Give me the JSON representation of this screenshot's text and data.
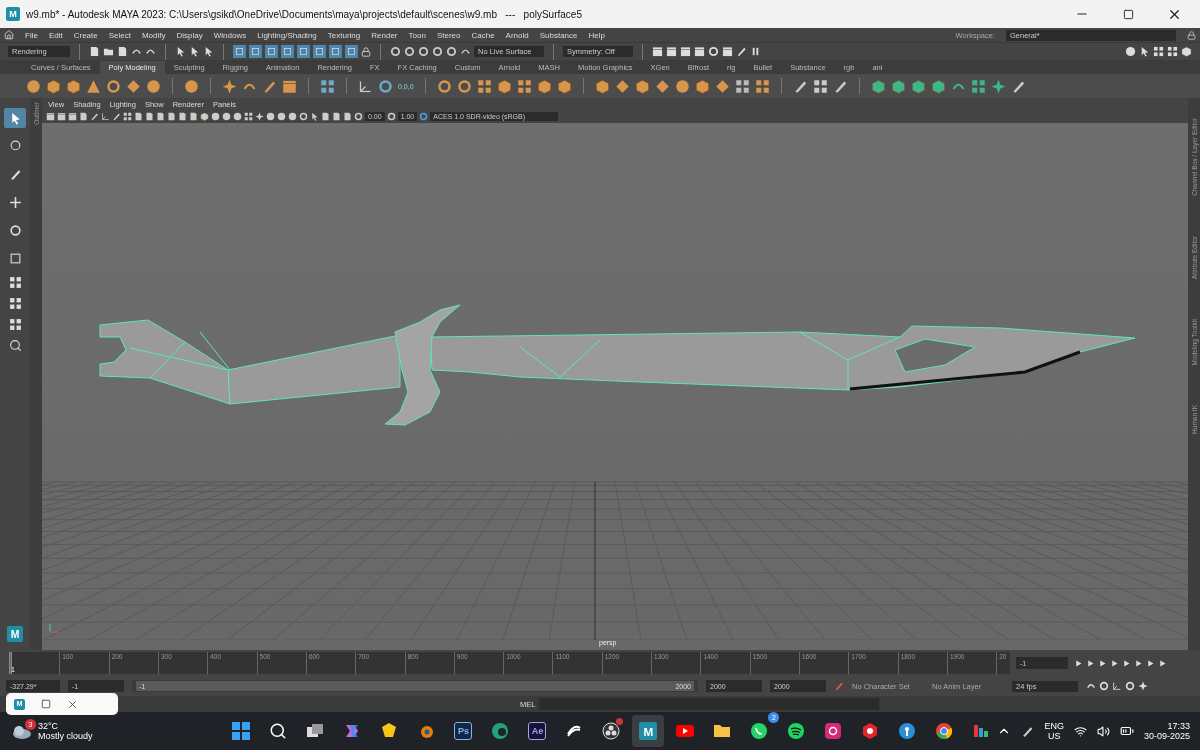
{
  "window": {
    "logo_letter": "M",
    "title": "w9.mb* - Autodesk MAYA 2023: C:\\Users\\gsikd\\OneDrive\\Documents\\maya\\projects\\default\\scenes\\w9.mb   ---   polySurface5"
  },
  "menu_bar": [
    "File",
    "Edit",
    "Create",
    "Select",
    "Modify",
    "Display",
    "Windows",
    "Lighting/Shading",
    "Texturing",
    "Render",
    "Toon",
    "Stereo",
    "Cache",
    "Arnold",
    "Substance",
    "Help"
  ],
  "workspace": {
    "label": "Workspace:",
    "value": "General*"
  },
  "status_line": {
    "menu_set": "Rendering",
    "live_surface": "No Live Surface",
    "symmetry": "Symmetry: Off",
    "mask_buttons": [
      {
        "on": true
      },
      {
        "on": true
      },
      {
        "on": true
      },
      {
        "on": true
      },
      {
        "on": true
      },
      {
        "on": true
      },
      {
        "on": true
      },
      {
        "on": true
      }
    ]
  },
  "shelf_tabs": [
    {
      "label": "Curves / Surfaces",
      "selected": false
    },
    {
      "label": "Poly Modeling",
      "selected": true
    },
    {
      "label": "Sculpting",
      "selected": false
    },
    {
      "label": "Rigging",
      "selected": false
    },
    {
      "label": "Animation",
      "selected": false
    },
    {
      "label": "Rendering",
      "selected": false
    },
    {
      "label": "FX",
      "selected": false
    },
    {
      "label": "FX Caching",
      "selected": false
    },
    {
      "label": "Custom",
      "selected": false
    },
    {
      "label": "Arnold",
      "selected": false
    },
    {
      "label": "MASH",
      "selected": false
    },
    {
      "label": "Motion Graphics",
      "selected": false
    },
    {
      "label": "XGen",
      "selected": false
    },
    {
      "label": "Bifrost",
      "selected": false
    },
    {
      "label": "rig",
      "selected": false
    },
    {
      "label": "Bullet",
      "selected": false
    },
    {
      "label": "Substance",
      "selected": false
    },
    {
      "label": "rgb",
      "selected": false
    },
    {
      "label": "ani",
      "selected": false
    }
  ],
  "shelf": {
    "pivot_caption": "0,0,0"
  },
  "toolbox": {
    "logo_letter": "M",
    "tools": [
      {
        "kind": "select",
        "selected": true
      },
      {
        "kind": "lasso",
        "selected": false
      },
      {
        "kind": "paint",
        "selected": false
      },
      {
        "kind": "move",
        "selected": false
      },
      {
        "kind": "rotate",
        "selected": false
      },
      {
        "kind": "scale",
        "selected": false
      }
    ]
  },
  "outliner_tab": "Outliner",
  "panel_menu": [
    "View",
    "Shading",
    "Lighting",
    "Show",
    "Renderer",
    "Panels"
  ],
  "panel_toolbar": {
    "exposure": "0.00",
    "gamma": "1.00",
    "view_transform": "ACES 1.0 SDR-video (sRGB)"
  },
  "viewport": {
    "camera": "persp"
  },
  "right_tabs": [
    "Channel Box / Layer Editor",
    "Attribute Editor",
    "Modeling Toolkit",
    "Human IK"
  ],
  "time_slider": {
    "level": 0,
    "current_marker": "1",
    "ticks": [
      "100",
      "200",
      "300",
      "400",
      "500",
      "600",
      "700",
      "800",
      "900",
      "1000",
      "1100",
      "1200",
      "1300",
      "1400",
      "1500",
      "1600",
      "1700",
      "1800",
      "1900"
    ],
    "cut_tick": "20",
    "current_frame": "-1"
  },
  "range_slider": {
    "level": 1,
    "current_value": "-327.29*",
    "start": "-1",
    "range_start": "-1",
    "range_end": "2000",
    "animation_end": "2000",
    "playback_end": "2000",
    "character_set": "No Character Set",
    "anim_layer": "No Anim Layer",
    "fps": "24 fps"
  },
  "command_line": {
    "label": "MEL"
  },
  "taskbar_preview": {
    "logo_letter": "M"
  },
  "taskbar": {
    "weather": {
      "badge": "3",
      "temperature": "32°C",
      "condition": "Mostly cloudy"
    },
    "apps": [
      {
        "kind": "windows"
      },
      {
        "kind": "search"
      },
      {
        "kind": "taskview"
      },
      {
        "kind": "copilot"
      },
      {
        "kind": "norton"
      },
      {
        "kind": "blender"
      },
      {
        "kind": "tile",
        "label": "Ps",
        "color": "#0b2a4a"
      },
      {
        "kind": "edge"
      },
      {
        "kind": "tile",
        "label": "Ae",
        "color": "#1a0f3d"
      },
      {
        "kind": "swirl"
      },
      {
        "kind": "obs",
        "notification": true
      },
      {
        "kind": "maya",
        "label": "M",
        "selected": true
      },
      {
        "kind": "youtube"
      },
      {
        "kind": "folder"
      },
      {
        "kind": "whatsapp",
        "badge": "2"
      },
      {
        "kind": "spotify"
      },
      {
        "kind": "instagram"
      },
      {
        "kind": "redapp"
      },
      {
        "kind": "bluecircle"
      },
      {
        "kind": "chrome"
      },
      {
        "kind": "bars"
      }
    ],
    "language": "ENG",
    "region": "US",
    "time": "17:33",
    "date": "30-09-2025"
  }
}
